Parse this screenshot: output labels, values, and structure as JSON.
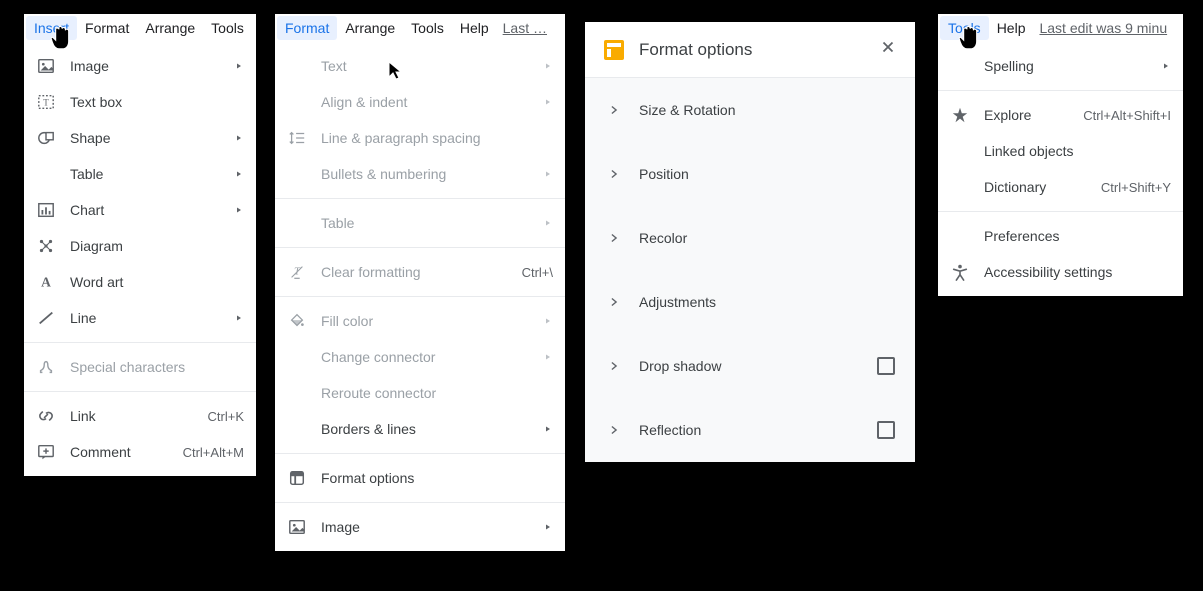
{
  "panel1": {
    "menubar": [
      "Insert",
      "Format",
      "Arrange",
      "Tools"
    ],
    "active": "Insert",
    "items": [
      {
        "icon": "image",
        "label": "Image",
        "arrow": true
      },
      {
        "icon": "textbox",
        "label": "Text box"
      },
      {
        "icon": "shape",
        "label": "Shape",
        "arrow": true
      },
      {
        "icon": "spacer",
        "label": "Table",
        "arrow": true
      },
      {
        "icon": "chart",
        "label": "Chart",
        "arrow": true
      },
      {
        "icon": "diagram",
        "label": "Diagram"
      },
      {
        "icon": "wordart",
        "label": "Word art"
      },
      {
        "icon": "line",
        "label": "Line",
        "arrow": true
      },
      {
        "sep": true
      },
      {
        "icon": "omega",
        "label": "Special characters",
        "disabled": true
      },
      {
        "sep": true
      },
      {
        "icon": "link",
        "label": "Link",
        "shortcut": "Ctrl+K"
      },
      {
        "icon": "comment",
        "label": "Comment",
        "shortcut": "Ctrl+Alt+M"
      }
    ]
  },
  "panel2": {
    "menubar": [
      "Format",
      "Arrange",
      "Tools",
      "Help"
    ],
    "active": "Format",
    "last_edit": "Last …",
    "items": [
      {
        "icon": "spacer",
        "label": "Text",
        "arrow": true,
        "disabled": true
      },
      {
        "icon": "spacer",
        "label": "Align & indent",
        "arrow": true,
        "disabled": true
      },
      {
        "icon": "linespacing",
        "label": "Line & paragraph spacing",
        "disabled": true
      },
      {
        "icon": "spacer",
        "label": "Bullets & numbering",
        "arrow": true,
        "disabled": true
      },
      {
        "sep": true
      },
      {
        "icon": "spacer",
        "label": "Table",
        "arrow": true,
        "disabled": true
      },
      {
        "sep": true
      },
      {
        "icon": "clear",
        "label": "Clear formatting",
        "shortcut": "Ctrl+\\",
        "disabled": true
      },
      {
        "sep": true
      },
      {
        "icon": "fill",
        "label": "Fill color",
        "arrow": true,
        "disabled": true
      },
      {
        "icon": "spacer",
        "label": "Change connector",
        "arrow": true,
        "disabled": true
      },
      {
        "icon": "spacer",
        "label": "Reroute connector",
        "disabled": true
      },
      {
        "icon": "spacer",
        "label": "Borders & lines",
        "arrow": true
      },
      {
        "sep": true
      },
      {
        "icon": "formatoptions",
        "label": "Format options"
      },
      {
        "sep": true
      },
      {
        "icon": "image",
        "label": "Image",
        "arrow": true
      }
    ]
  },
  "panel3": {
    "title": "Format options",
    "rows": [
      {
        "label": "Size & Rotation"
      },
      {
        "label": "Position"
      },
      {
        "label": "Recolor"
      },
      {
        "label": "Adjustments"
      },
      {
        "label": "Drop shadow",
        "checkbox": true
      },
      {
        "label": "Reflection",
        "checkbox": true
      }
    ]
  },
  "panel4": {
    "menubar": [
      "Tools",
      "Help"
    ],
    "active": "Tools",
    "last_edit": "Last edit was 9 minu",
    "items": [
      {
        "icon": "spacer",
        "label": "Spelling",
        "arrow": true
      },
      {
        "sep": true
      },
      {
        "icon": "explore",
        "label": "Explore",
        "shortcut": "Ctrl+Alt+Shift+I"
      },
      {
        "icon": "spacer",
        "label": "Linked objects"
      },
      {
        "icon": "spacer",
        "label": "Dictionary",
        "shortcut": "Ctrl+Shift+Y"
      },
      {
        "sep": true
      },
      {
        "icon": "spacer",
        "label": "Preferences"
      },
      {
        "icon": "accessibility",
        "label": "Accessibility settings"
      }
    ]
  }
}
